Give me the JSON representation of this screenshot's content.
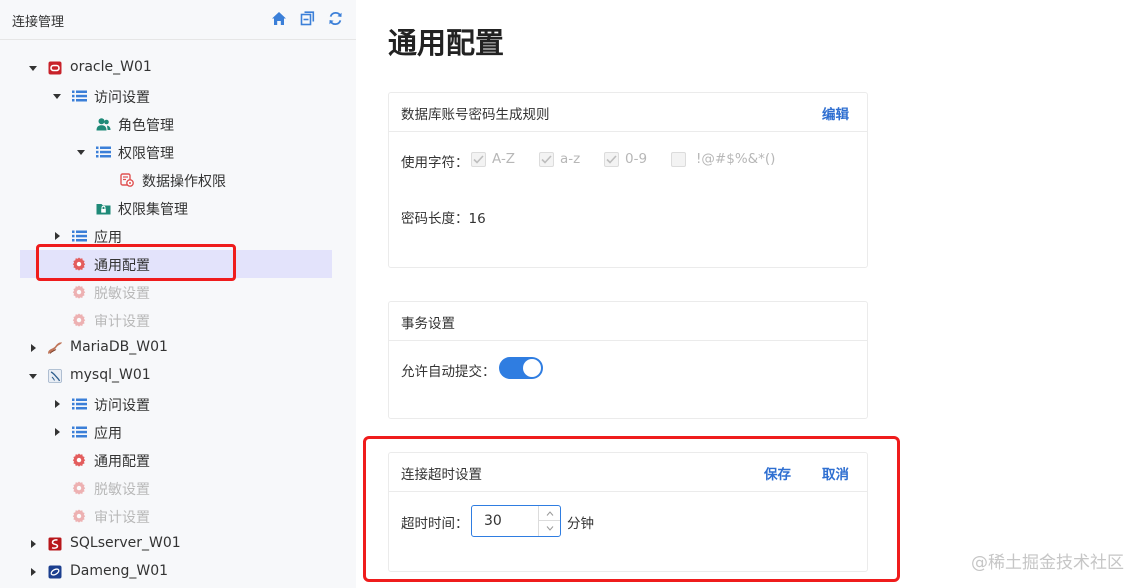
{
  "sidebar": {
    "title": "连接管理",
    "tools": [
      "home-icon",
      "collapse-icon",
      "refresh-icon"
    ],
    "tree": [
      {
        "label": "oracle_W01",
        "level": 0,
        "arrow": "down",
        "icon": "oracle-db-icon"
      },
      {
        "label": "访问设置",
        "level": 1,
        "arrow": "down",
        "icon": "list-icon"
      },
      {
        "label": "角色管理",
        "level": 2,
        "arrow": "",
        "icon": "users-icon"
      },
      {
        "label": "权限管理",
        "level": 2,
        "arrow": "down",
        "icon": "list-icon"
      },
      {
        "label": "数据操作权限",
        "level": 3,
        "arrow": "",
        "icon": "permission-icon"
      },
      {
        "label": "权限集管理",
        "level": 2,
        "arrow": "",
        "icon": "folder-lock-icon"
      },
      {
        "label": "应用",
        "level": 1,
        "arrow": "right",
        "icon": "list-icon"
      },
      {
        "label": "通用配置",
        "level": 1,
        "arrow": "",
        "icon": "gear-icon",
        "selected": true
      },
      {
        "label": "脱敏设置",
        "level": 1,
        "arrow": "",
        "icon": "gear-icon",
        "disabled": true
      },
      {
        "label": "审计设置",
        "level": 1,
        "arrow": "",
        "icon": "gear-icon",
        "disabled": true
      },
      {
        "label": "MariaDB_W01",
        "level": 0,
        "arrow": "right",
        "icon": "mariadb-icon"
      },
      {
        "label": "mysql_W01",
        "level": 0,
        "arrow": "down",
        "icon": "mysql-icon"
      },
      {
        "label": "访问设置",
        "level": 1,
        "arrow": "right",
        "icon": "list-icon"
      },
      {
        "label": "应用",
        "level": 1,
        "arrow": "right",
        "icon": "list-icon"
      },
      {
        "label": "通用配置",
        "level": 1,
        "arrow": "",
        "icon": "gear-icon"
      },
      {
        "label": "脱敏设置",
        "level": 1,
        "arrow": "",
        "icon": "gear-icon",
        "disabled": true
      },
      {
        "label": "审计设置",
        "level": 1,
        "arrow": "",
        "icon": "gear-icon",
        "disabled": true
      },
      {
        "label": "SQLserver_W01",
        "level": 0,
        "arrow": "right",
        "icon": "sqlserver-icon"
      },
      {
        "label": "Dameng_W01",
        "level": 0,
        "arrow": "right",
        "icon": "dameng-icon"
      }
    ]
  },
  "main": {
    "title": "通用配置",
    "password_card": {
      "title": "数据库账号密码生成规则",
      "edit_label": "编辑",
      "chars_label": "使用字符：",
      "options": [
        {
          "label": "A-Z",
          "checked": true
        },
        {
          "label": "a-z",
          "checked": true
        },
        {
          "label": "0-9",
          "checked": true
        },
        {
          "label": "!@#$%&*()",
          "checked": false
        }
      ],
      "length_label": "密码长度：",
      "length_value": "16"
    },
    "transaction_card": {
      "title": "事务设置",
      "autocommit_label": "允许自动提交：",
      "autocommit_on": true
    },
    "timeout_card": {
      "title": "连接超时设置",
      "save_label": "保存",
      "cancel_label": "取消",
      "timeout_label": "超时时间：",
      "timeout_value": "30",
      "unit": "分钟"
    }
  },
  "watermark": "@稀土掘金技术社区",
  "colors": {
    "accent": "#2f7de1",
    "link": "#2f6fd1",
    "highlight": "#ef1c1c",
    "selected_bg": "#e3e3fb"
  }
}
